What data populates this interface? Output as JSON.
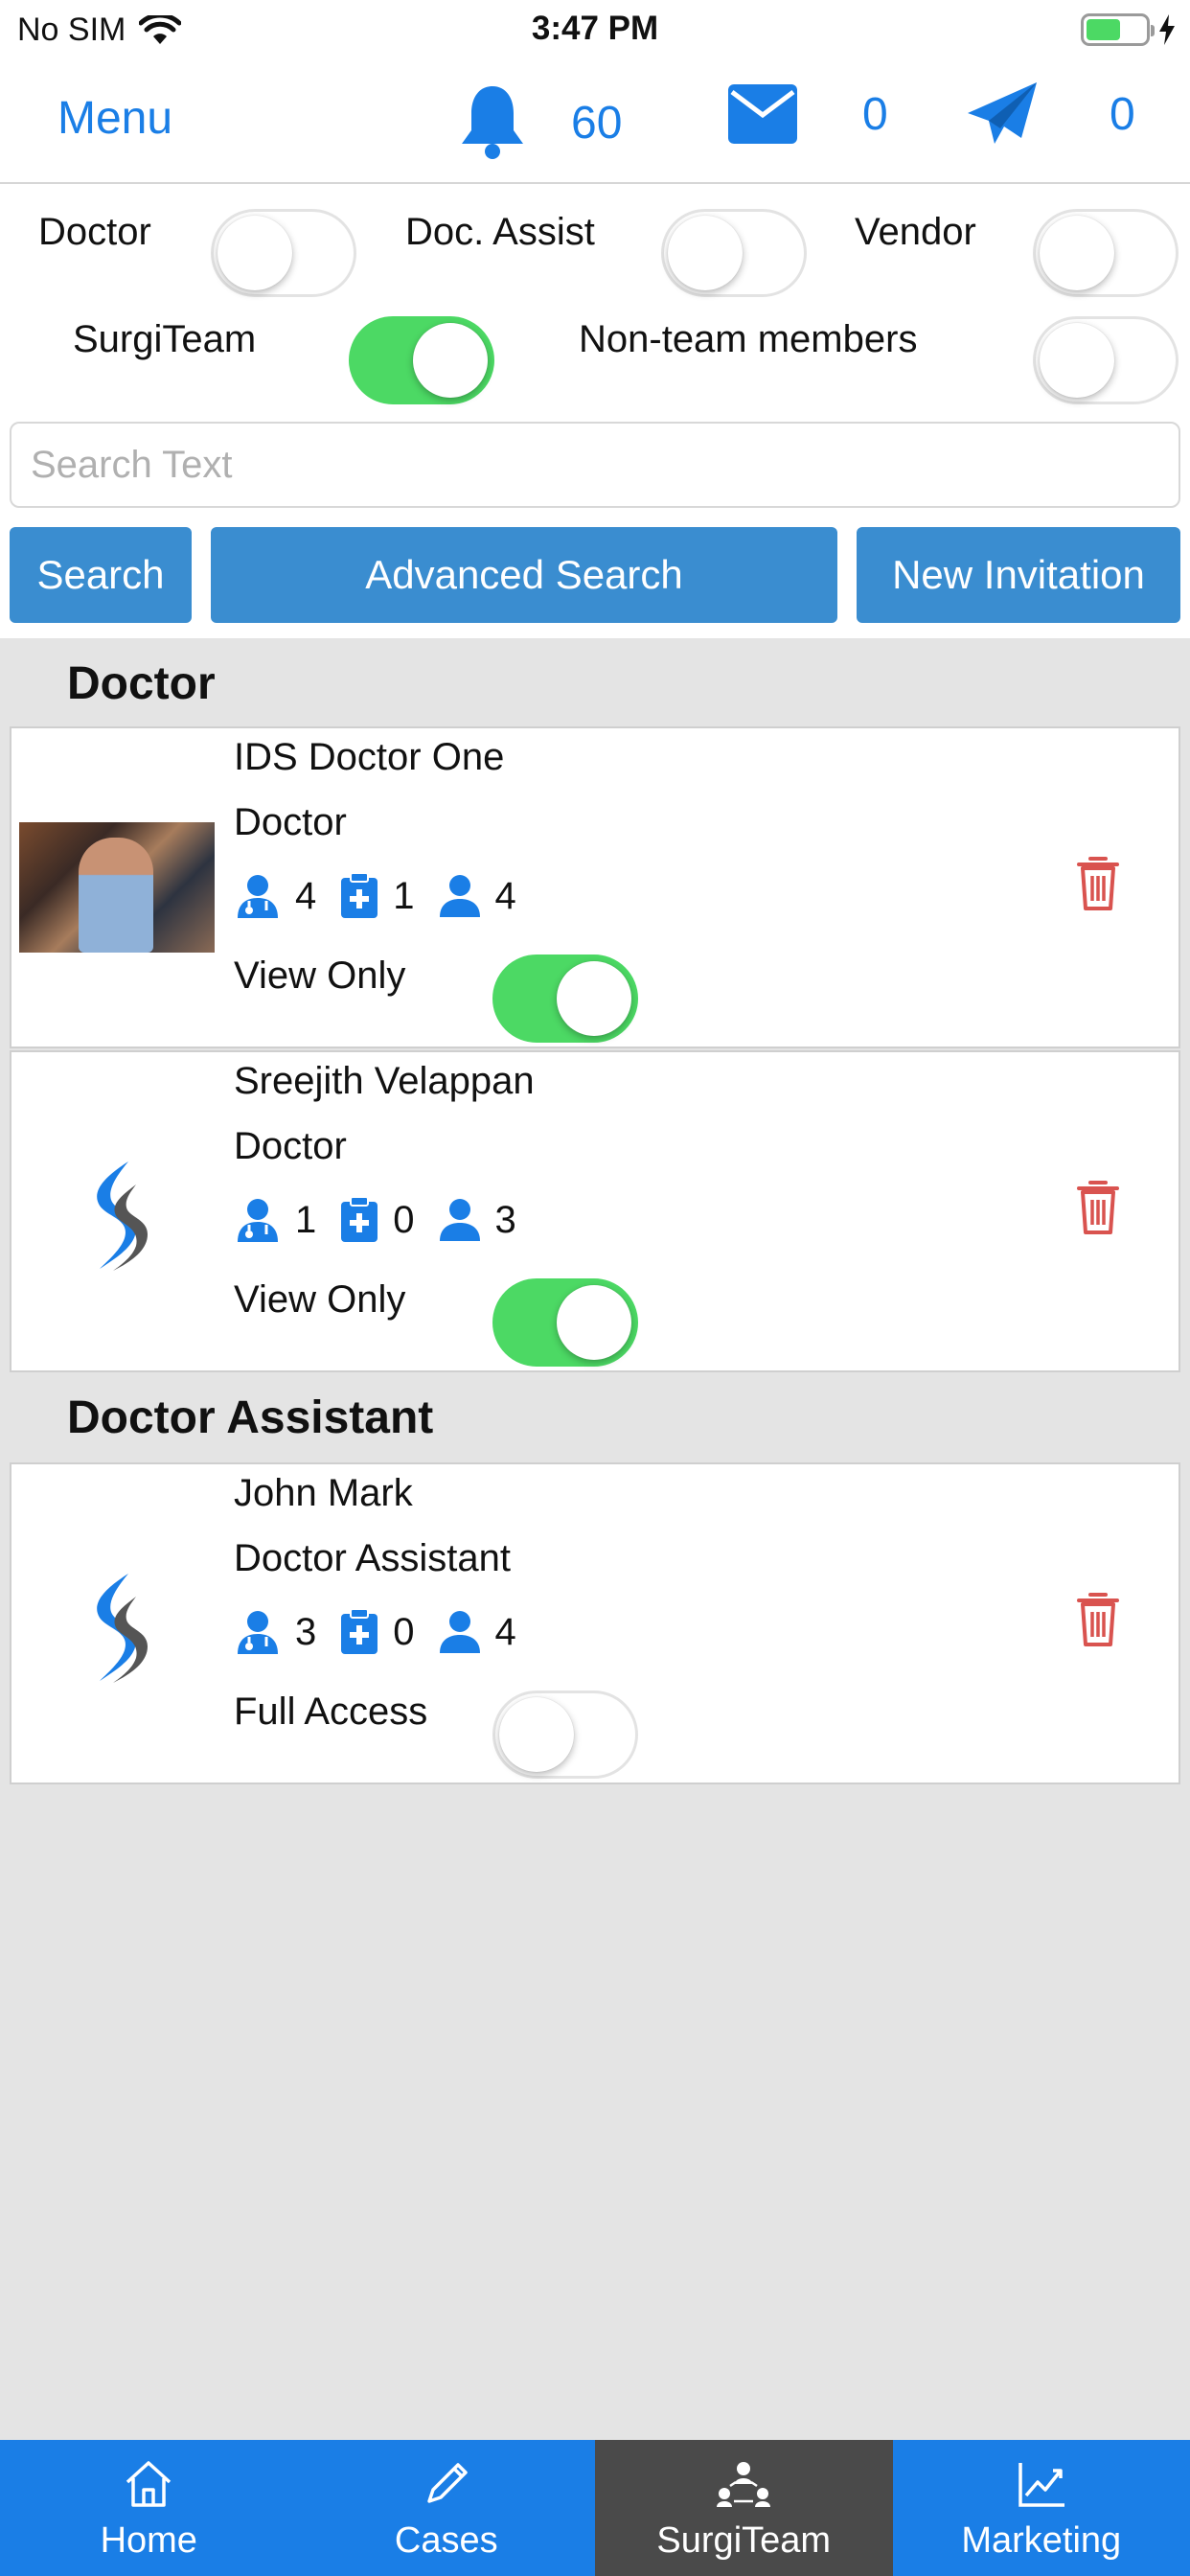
{
  "status_bar": {
    "carrier": "No SIM",
    "time": "3:47 PM"
  },
  "nav": {
    "menu_label": "Menu",
    "notifications_count": "60",
    "messages_count": "0",
    "sent_count": "0"
  },
  "filters": [
    {
      "label": "Doctor",
      "on": false
    },
    {
      "label": "Doc. Assist",
      "on": false
    },
    {
      "label": "Vendor",
      "on": false
    },
    {
      "label": "SurgiTeam",
      "on": true
    },
    {
      "label": "Non-team members",
      "on": false
    }
  ],
  "search": {
    "placeholder": "Search Text",
    "value": ""
  },
  "buttons": {
    "search": "Search",
    "advanced": "Advanced Search",
    "invite": "New Invitation"
  },
  "sections": [
    {
      "title": "Doctor",
      "members": [
        {
          "name": "IDS Doctor One",
          "role": "Doctor",
          "stats": [
            "4",
            "1",
            "4"
          ],
          "access": "View Only",
          "access_on": true
        },
        {
          "name": "Sreejith Velappan",
          "role": "Doctor",
          "stats": [
            "1",
            "0",
            "3"
          ],
          "access": "View Only",
          "access_on": true
        }
      ]
    },
    {
      "title": "Doctor Assistant",
      "members": [
        {
          "name": "John Mark",
          "role": "Doctor Assistant",
          "stats": [
            "3",
            "0",
            "4"
          ],
          "access": "Full Access",
          "access_on": false
        }
      ]
    }
  ],
  "tabs": [
    {
      "label": "Home",
      "icon": "home-icon"
    },
    {
      "label": "Cases",
      "icon": "pen-icon"
    },
    {
      "label": "SurgiTeam",
      "icon": "team-icon",
      "active": true
    },
    {
      "label": "Marketing",
      "icon": "chart-icon"
    }
  ],
  "colors": {
    "accent": "#1a7ee6",
    "button": "#3a8dd0",
    "toggle_on": "#4cd964",
    "trash": "#d9534f",
    "tab_active": "#4a4a4a"
  }
}
